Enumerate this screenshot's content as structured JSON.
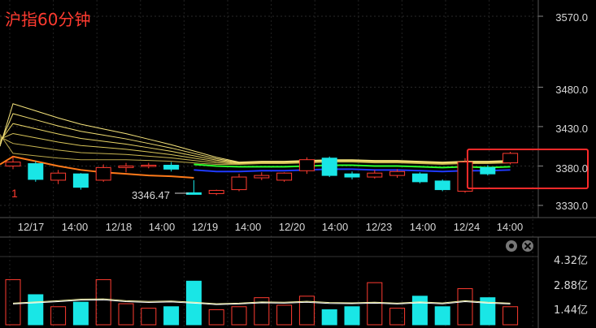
{
  "header": {
    "title": "沪指60分钟"
  },
  "price_axis": {
    "labels": [
      "3570.0",
      "3480.0",
      "3430.0",
      "3380.0",
      "3330.0"
    ]
  },
  "time_axis": {
    "labels": [
      "12/17",
      "14:00",
      "12/18",
      "14:00",
      "12/19",
      "14:00",
      "12/20",
      "14:00",
      "12/23",
      "14:00",
      "12/24",
      "14:00"
    ]
  },
  "volume_axis": {
    "labels": [
      "4.32亿",
      "2.88亿",
      "1.44亿"
    ]
  },
  "annotations": {
    "low_price": "3346.47",
    "marker": "1"
  },
  "icons": {
    "settings": "gear-icon",
    "close": "close-icon"
  },
  "colors": {
    "up": "#ff3b30",
    "down": "#19e6e6",
    "ma_green": "#2bff2b",
    "ma_blue": "#1f3bff",
    "highlight": "#ff2a2a"
  },
  "chart_data": {
    "type": "candlestick",
    "title": "沪指60分钟",
    "y_ticks": [
      3570.0,
      3480.0,
      3430.0,
      3380.0,
      3330.0
    ],
    "candles": [
      {
        "o": 3380,
        "h": 3392,
        "l": 3376,
        "c": 3385
      },
      {
        "o": 3383,
        "h": 3386,
        "l": 3360,
        "c": 3363
      },
      {
        "o": 3362,
        "h": 3375,
        "l": 3357,
        "c": 3371
      },
      {
        "o": 3370,
        "h": 3371,
        "l": 3350,
        "c": 3353
      },
      {
        "o": 3362,
        "h": 3382,
        "l": 3360,
        "c": 3378
      },
      {
        "o": 3378,
        "h": 3384,
        "l": 3372,
        "c": 3380
      },
      {
        "o": 3380,
        "h": 3384,
        "l": 3377,
        "c": 3381
      },
      {
        "o": 3381,
        "h": 3385,
        "l": 3373,
        "c": 3376
      },
      {
        "o": 3346,
        "h": 3362,
        "l": 3346,
        "c": 3344
      },
      {
        "o": 3345,
        "h": 3350,
        "l": 3343,
        "c": 3349
      },
      {
        "o": 3350,
        "h": 3370,
        "l": 3348,
        "c": 3366
      },
      {
        "o": 3365,
        "h": 3372,
        "l": 3362,
        "c": 3368
      },
      {
        "o": 3362,
        "h": 3372,
        "l": 3360,
        "c": 3371
      },
      {
        "o": 3374,
        "h": 3391,
        "l": 3370,
        "c": 3388
      },
      {
        "o": 3390,
        "h": 3392,
        "l": 3366,
        "c": 3368
      },
      {
        "o": 3370,
        "h": 3373,
        "l": 3363,
        "c": 3366
      },
      {
        "o": 3366,
        "h": 3375,
        "l": 3364,
        "c": 3371
      },
      {
        "o": 3368,
        "h": 3376,
        "l": 3365,
        "c": 3373
      },
      {
        "o": 3370,
        "h": 3372,
        "l": 3358,
        "c": 3360
      },
      {
        "o": 3361,
        "h": 3363,
        "l": 3348,
        "c": 3350
      },
      {
        "o": 3348,
        "h": 3390,
        "l": 3346,
        "c": 3385
      },
      {
        "o": 3378,
        "h": 3381,
        "l": 3368,
        "c": 3370
      },
      {
        "o": 3384,
        "h": 3398,
        "l": 3382,
        "c": 3396
      }
    ],
    "ma_lines": [
      {
        "values": [
          3390,
          3387,
          3384,
          3382,
          3382,
          3382,
          3381,
          3380,
          3378,
          3376,
          3376,
          3377,
          3377,
          3378,
          3379,
          3379,
          3378,
          3378,
          3377,
          3376,
          3377,
          3377,
          3378
        ]
      },
      {
        "values": [
          3400,
          3396,
          3392,
          3389,
          3387,
          3386,
          3385,
          3384,
          3382,
          3380,
          3379,
          3379,
          3379,
          3380,
          3381,
          3381,
          3380,
          3380,
          3379,
          3378,
          3379,
          3378,
          3379
        ]
      },
      {
        "values": [
          3412,
          3406,
          3400,
          3395,
          3392,
          3390,
          3388,
          3387,
          3385,
          3383,
          3382,
          3381,
          3381,
          3381,
          3382,
          3382,
          3381,
          3381,
          3380,
          3379,
          3380,
          3379,
          3380
        ]
      }
    ],
    "volume": [
      3.0,
      2.0,
      1.2,
      1.5,
      3.0,
      1.4,
      1.1,
      1.2,
      2.9,
      1.0,
      1.2,
      1.8,
      1.3,
      1.9,
      1.0,
      1.2,
      2.8,
      1.1,
      1.9,
      1.2,
      2.4,
      1.8,
      1.2
    ],
    "volume_ma": [
      1.44,
      1.52,
      1.6,
      1.7,
      1.72,
      1.6,
      1.55,
      1.58,
      1.5,
      1.4,
      1.44,
      1.52,
      1.5,
      1.56,
      1.48,
      1.46,
      1.5,
      1.44,
      1.52,
      1.45,
      1.6,
      1.5,
      1.44
    ]
  }
}
